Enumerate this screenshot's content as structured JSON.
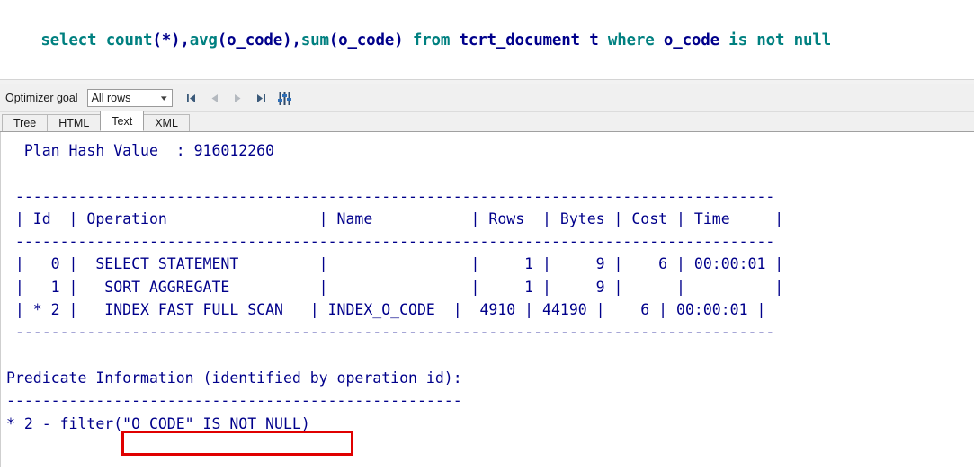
{
  "sql_statement": {
    "full_text": "select count(*),avg(o_code),sum(o_code) from tcrt_document t where o_code is not null",
    "tokens": [
      {
        "t": "select ",
        "c": "kw"
      },
      {
        "t": "count",
        "c": "kw"
      },
      {
        "t": "(*),",
        "c": "idn"
      },
      {
        "t": "avg",
        "c": "kw"
      },
      {
        "t": "(o_code),",
        "c": "idn"
      },
      {
        "t": "sum",
        "c": "kw"
      },
      {
        "t": "(o_code) ",
        "c": "idn"
      },
      {
        "t": "from ",
        "c": "kw"
      },
      {
        "t": "tcrt_document t ",
        "c": "idn"
      },
      {
        "t": "where ",
        "c": "kw"
      },
      {
        "t": "o_code ",
        "c": "idn"
      },
      {
        "t": "is not null",
        "c": "kw"
      }
    ]
  },
  "toolbar": {
    "optimizer_goal_label": "Optimizer goal",
    "optimizer_goal_value": "All rows",
    "optimizer_goal_options": [
      "All rows"
    ],
    "nav_first": "first-record",
    "nav_prev": "previous-record",
    "nav_next": "next-record",
    "nav_last": "last-record",
    "sliders": "plan-options"
  },
  "tabs": [
    {
      "label": "Tree",
      "active": false
    },
    {
      "label": "HTML",
      "active": false
    },
    {
      "label": "Text",
      "active": true
    },
    {
      "label": "XML",
      "active": false
    }
  ],
  "plan": {
    "hash_label": "Plan Hash Value",
    "hash_value": "916012260",
    "hash_line": "  Plan Hash Value  : 916012260",
    "separator": " -------------------------------------------------------------------------------------",
    "header_line": " | Id  | Operation                 | Name           | Rows  | Bytes | Cost | Time     |",
    "rows": [
      {
        "id": "0",
        "star": "",
        "operation": "SELECT STATEMENT",
        "name": "",
        "rows": "1",
        "bytes": "9",
        "cost": "6",
        "time": "00:00:01",
        "line": " |   0 |  SELECT STATEMENT         |                |     1 |     9 |    6 | 00:00:01 |"
      },
      {
        "id": "1",
        "star": "",
        "operation": "SORT AGGREGATE",
        "name": "",
        "rows": "1",
        "bytes": "9",
        "cost": "",
        "time": "",
        "line": " |   1 |   SORT AGGREGATE          |                |     1 |     9 |      |          |"
      },
      {
        "id": "2",
        "star": "*",
        "operation": "INDEX FAST FULL SCAN",
        "name": "INDEX_O_CODE",
        "rows": "4910",
        "bytes": "44190",
        "cost": "6",
        "time": "00:00:01",
        "line": " | * 2 |   INDEX FAST FULL SCAN   | INDEX_O_CODE  |  4910 | 44190 |    6 | 00:00:01 |"
      }
    ],
    "highlight": {
      "text": "INDEX FAST FULL SCAN",
      "color": "#e00000"
    },
    "predicate_title": "Predicate Information (identified by operation id):",
    "predicate_rule": "---------------------------------------------------",
    "predicate_lines": [
      "* 2 - filter(\"O_CODE\" IS NOT NULL)"
    ]
  },
  "colors": {
    "sql_keyword": "#008080",
    "sql_identifier": "#00008b",
    "plan_text": "#00008b",
    "highlight_red": "#e00000",
    "chrome": "#f0f0f0"
  }
}
